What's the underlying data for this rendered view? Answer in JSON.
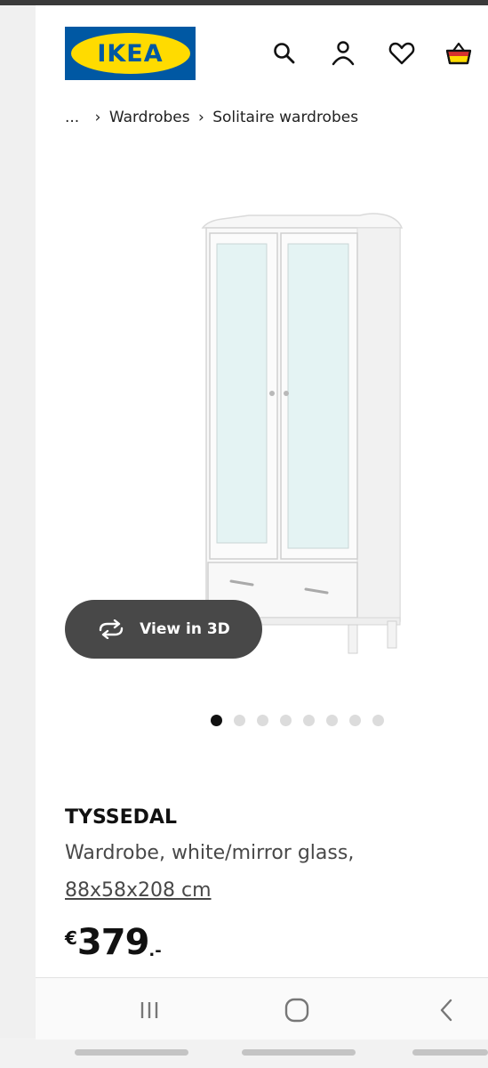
{
  "header": {
    "logo_text": "IKEA",
    "icons": [
      "search-icon",
      "profile-icon",
      "heart-icon",
      "basket-icon"
    ],
    "brand_blue": "#0058a3",
    "brand_yellow": "#ffdb00",
    "basket_accent": "#d6322f"
  },
  "breadcrumb": {
    "ellipsis": "...",
    "items": [
      "Wardrobes",
      "Solitaire wardrobes"
    ]
  },
  "gallery": {
    "view_3d_label": "View in 3D",
    "dot_count": 8,
    "active_index": 0
  },
  "product": {
    "name": "TYSSEDAL",
    "description": "Wardrobe, white/mirror glass,",
    "size": "88x58x208 cm",
    "currency": "€",
    "price": "379",
    "price_suffix": ".-"
  },
  "navbar": {
    "icons": [
      "recent-apps-icon",
      "home-icon",
      "back-icon"
    ]
  }
}
